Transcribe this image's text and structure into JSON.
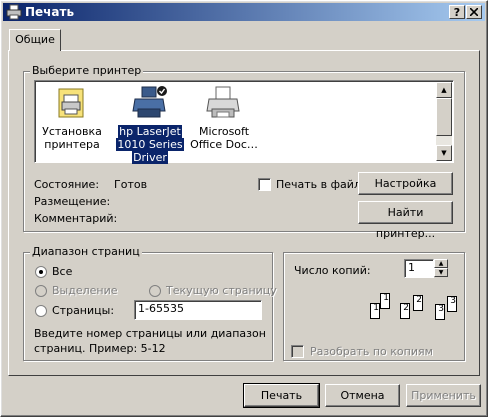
{
  "window": {
    "title": "Печать",
    "help_btn": "?",
    "close_btn": "X"
  },
  "tabs": [
    {
      "label": "Общие"
    }
  ],
  "select_printer": {
    "legend": "Выберите принтер",
    "printers": [
      {
        "line1": "Установка",
        "line2": "принтера",
        "line3": "",
        "icon": "add-printer-icon"
      },
      {
        "line1": "hp LaserJet",
        "line2": "1010 Series",
        "line3": "Driver",
        "icon": "default-printer-icon",
        "selected": true
      },
      {
        "line1": "Microsoft",
        "line2": "Office Doc…",
        "line3": "",
        "icon": "printer-icon"
      }
    ],
    "status_label": "Состояние:",
    "status_value": "Готов",
    "location_label": "Размещение:",
    "comment_label": "Комментарий:",
    "print_to_file": "Печать в файл",
    "settings_button": "Настройка",
    "find_button": "Найти принтер..."
  },
  "page_range": {
    "legend": "Диапазон страниц",
    "all": "Все",
    "selection": "Выделение",
    "current": "Текущую страницу",
    "pages": "Страницы:",
    "pages_value": "1-65535",
    "hint_line1": "Введите номер страницы или диапазон",
    "hint_line2": "страниц.  Пример: 5-12"
  },
  "copies": {
    "label": "Число копий:",
    "value": "1",
    "collate": "Разобрать по копиям",
    "page_numbers": [
      "1",
      "1",
      "2",
      "2",
      "3",
      "3"
    ]
  },
  "footer": {
    "print": "Печать",
    "cancel": "Отмена",
    "apply": "Применить"
  }
}
